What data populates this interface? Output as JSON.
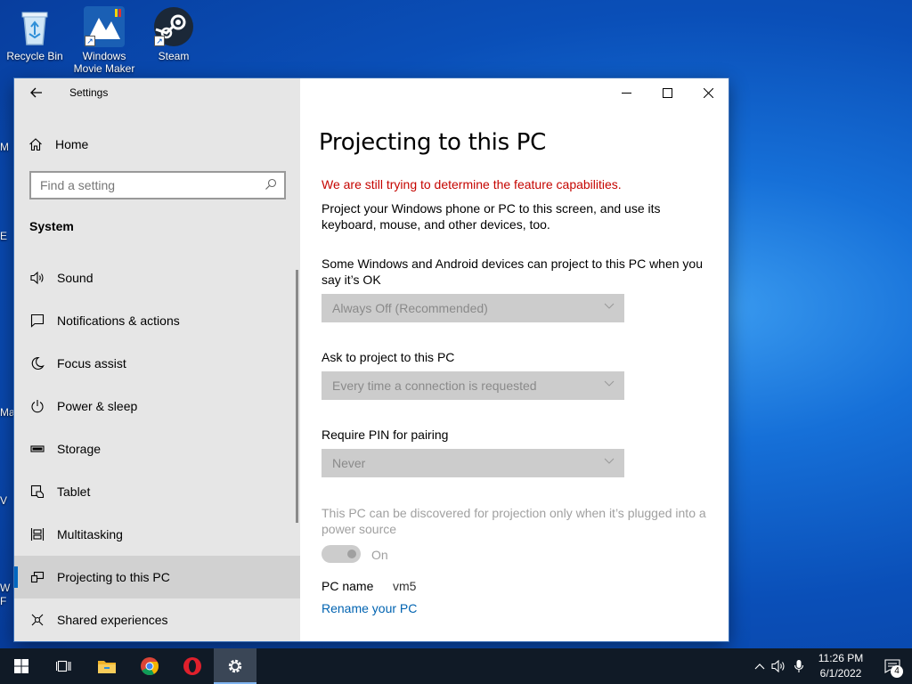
{
  "desktop": {
    "icons": [
      {
        "label": "Recycle Bin",
        "icon": "recycle-bin-icon"
      },
      {
        "label": "Windows Movie Maker",
        "icon": "movie-maker-icon"
      },
      {
        "label": "Steam",
        "icon": "steam-icon"
      }
    ],
    "edge_fragments": [
      "M",
      "E",
      "Ma",
      "V",
      "W",
      "F"
    ]
  },
  "window": {
    "title": "Settings",
    "controls": {
      "minimize": "—",
      "maximize": "☐",
      "close": "✕"
    }
  },
  "sidebar": {
    "home_label": "Home",
    "search_placeholder": "Find a setting",
    "group_label": "System",
    "items": [
      {
        "label": "Sound",
        "icon": "speaker-icon"
      },
      {
        "label": "Notifications & actions",
        "icon": "notifications-icon"
      },
      {
        "label": "Focus assist",
        "icon": "moon-icon"
      },
      {
        "label": "Power & sleep",
        "icon": "power-icon"
      },
      {
        "label": "Storage",
        "icon": "storage-icon"
      },
      {
        "label": "Tablet",
        "icon": "tablet-icon"
      },
      {
        "label": "Multitasking",
        "icon": "multitasking-icon"
      },
      {
        "label": "Projecting to this PC",
        "icon": "projecting-icon",
        "active": true
      },
      {
        "label": "Shared experiences",
        "icon": "shared-experiences-icon"
      }
    ]
  },
  "main": {
    "title": "Projecting to this PC",
    "warning": "We are still trying to determine the feature capabilities.",
    "description": "Project your Windows phone or PC to this screen, and use its keyboard, mouse, and other devices, too.",
    "setting1": {
      "label": "Some Windows and Android devices can project to this PC when you say it’s OK",
      "value": "Always Off (Recommended)"
    },
    "setting2": {
      "label": "Ask to project to this PC",
      "value": "Every time a connection is requested"
    },
    "setting3": {
      "label": "Require PIN for pairing",
      "value": "Never"
    },
    "power_note": "This PC can be discovered for projection only when it’s plugged into a power source",
    "toggle_label": "On",
    "pc_name_label": "PC name",
    "pc_name_value": "vm5",
    "rename_link": "Rename your PC"
  },
  "taskbar": {
    "apps": [
      "start-icon",
      "task-view-icon",
      "file-explorer-icon",
      "chrome-icon",
      "opera-icon",
      "settings-icon"
    ],
    "time": "11:26 PM",
    "date": "6/1/2022",
    "notification_count": "4",
    "colors": {
      "accent": "#0067c0",
      "warning": "#c50500",
      "link": "#0063b1"
    }
  }
}
